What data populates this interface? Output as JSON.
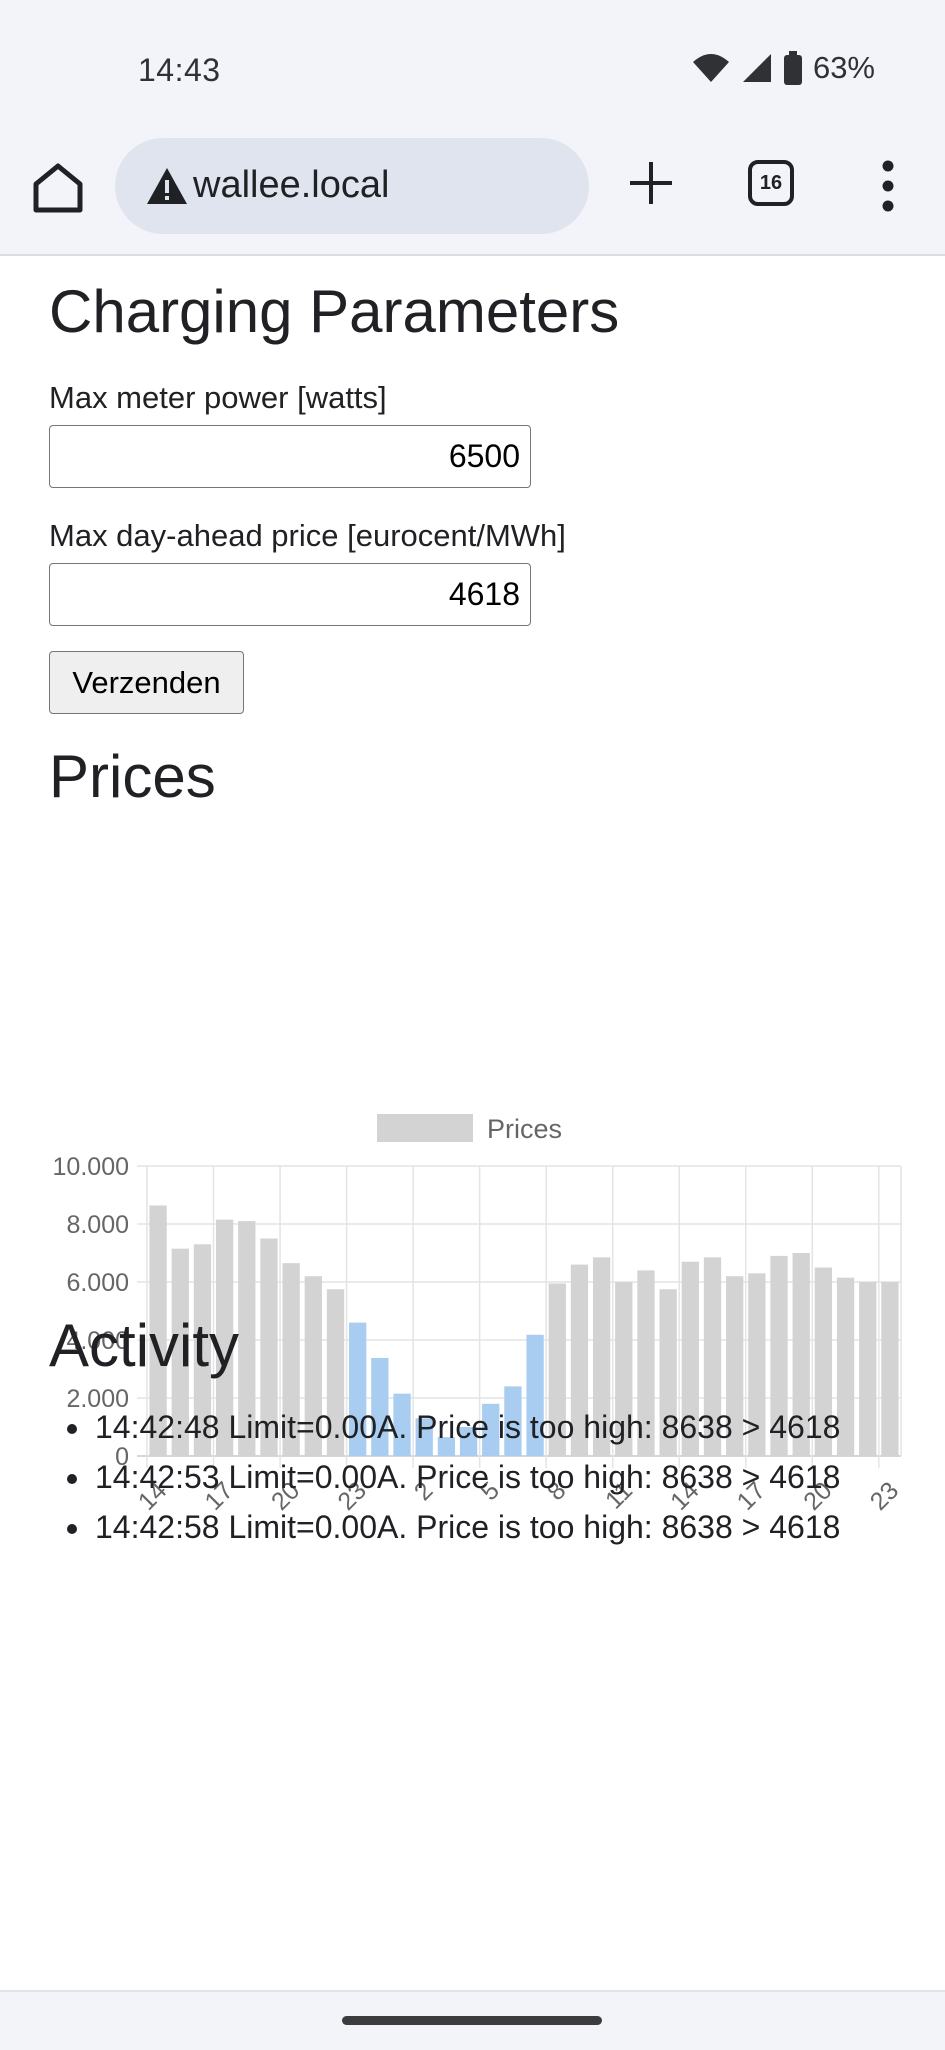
{
  "status_bar": {
    "time": "14:43",
    "battery": "63%",
    "wifi_icon": "wifi-icon",
    "signal_icon": "signal-icon",
    "battery_icon": "battery-icon"
  },
  "browser": {
    "url": "wallee.local",
    "tab_count": "16",
    "warning_icon": "warning-icon"
  },
  "page": {
    "charging": {
      "title": "Charging Parameters",
      "max_power_label": "Max meter power [watts]",
      "max_power_value": "6500",
      "max_price_label": "Max day-ahead price [eurocent/MWh]",
      "max_price_value": "4618",
      "submit_label": "Verzenden"
    },
    "prices_title": "Prices",
    "activity_title": "Activity",
    "activity": [
      "14:42:48 Limit=0.00A. Price is too high: 8638 > 4618",
      "14:42:53 Limit=0.00A. Price is too high: 8638 > 4618",
      "14:42:58 Limit=0.00A. Price is too high: 8638 > 4618"
    ]
  },
  "chart_data": {
    "type": "bar",
    "legend": "Prices",
    "legend_position": "top",
    "categories": [
      "14",
      "15",
      "16",
      "17",
      "18",
      "19",
      "20",
      "21",
      "22",
      "23",
      "0",
      "1",
      "2",
      "3",
      "4",
      "5",
      "6",
      "7",
      "8",
      "9",
      "10",
      "11",
      "12",
      "13",
      "14",
      "15",
      "16",
      "17",
      "18",
      "19",
      "20",
      "21",
      "22",
      "23"
    ],
    "x_tick_labels": [
      "14",
      "17",
      "20",
      "23",
      "2",
      "5",
      "8",
      "11",
      "14",
      "17",
      "20",
      "23"
    ],
    "values": [
      8638,
      7150,
      7300,
      8150,
      8100,
      7500,
      6650,
      6200,
      5750,
      4600,
      3380,
      2150,
      1300,
      650,
      1000,
      1800,
      2400,
      4180,
      5950,
      6600,
      6850,
      6000,
      6400,
      5750,
      6700,
      6850,
      6200,
      6300,
      6900,
      7000,
      6500,
      6150,
      6000,
      6000
    ],
    "highlighted": [
      false,
      false,
      false,
      false,
      false,
      false,
      false,
      false,
      false,
      true,
      true,
      true,
      true,
      true,
      true,
      true,
      true,
      true,
      false,
      false,
      false,
      false,
      false,
      false,
      false,
      false,
      false,
      false,
      false,
      false,
      false,
      false,
      false,
      false
    ],
    "y_ticks": [
      "0",
      "2.000",
      "4.000",
      "6.000",
      "8.000",
      "10.000"
    ],
    "ylim": [
      0,
      10000
    ],
    "grid": true,
    "colors": {
      "default": "#d3d3d3",
      "highlight": "#a9cdf0",
      "grid": "#e4e4e4"
    }
  }
}
